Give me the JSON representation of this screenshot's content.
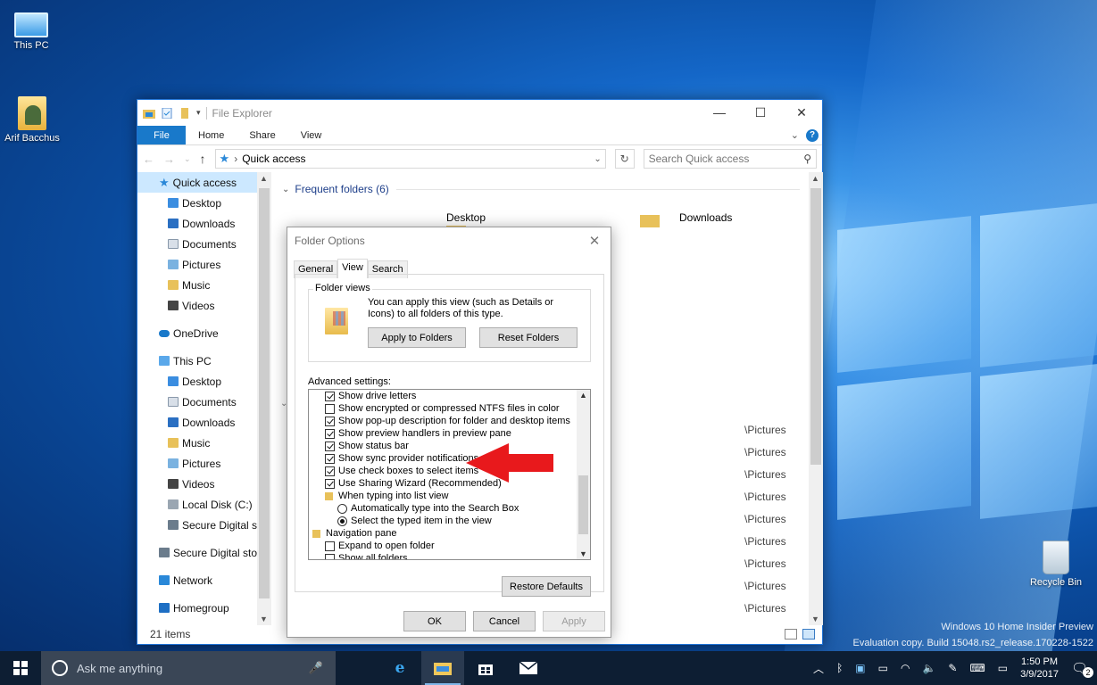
{
  "desktop": {
    "icons": [
      {
        "label": "This PC"
      },
      {
        "label": "Arif Bacchus"
      },
      {
        "label": "Recycle Bin"
      }
    ],
    "watermark_line1": "Windows 10 Home Insider Preview",
    "watermark_line2": "Evaluation copy. Build 15048.rs2_release.170228-1522"
  },
  "explorer": {
    "title": "File Explorer",
    "tabs": [
      "File",
      "Home",
      "Share",
      "View"
    ],
    "address": "Quick access",
    "search_placeholder": "Search Quick access",
    "nav": {
      "quick_access": "Quick access",
      "quick_items": [
        "Desktop",
        "Downloads",
        "Documents",
        "Pictures",
        "Music",
        "Videos"
      ],
      "onedrive": "OneDrive",
      "this_pc": "This PC",
      "pc_items": [
        "Desktop",
        "Documents",
        "Downloads",
        "Music",
        "Pictures",
        "Videos",
        "Local Disk (C:)",
        "Secure Digital sto"
      ],
      "secure_digital": "Secure Digital stor",
      "network": "Network",
      "homegroup": "Homegroup"
    },
    "frequent_folders": "Frequent folders (6)",
    "frequent_items": [
      "Desktop",
      "Downloads"
    ],
    "recent_paths": [
      "\\Pictures",
      "\\Pictures",
      "\\Pictures",
      "\\Pictures",
      "\\Pictures",
      "\\Pictures",
      "\\Pictures",
      "\\Pictures",
      "\\Pictures"
    ],
    "status": "21 items"
  },
  "dialog": {
    "title": "Folder Options",
    "tabs": [
      "General",
      "View",
      "Search"
    ],
    "folder_views_label": "Folder views",
    "folder_views_text": "You can apply this view (such as Details or Icons) to all folders of this type.",
    "apply_to_folders": "Apply to Folders",
    "reset_folders": "Reset Folders",
    "advanced_label": "Advanced settings:",
    "advanced_items": [
      {
        "type": "checkbox",
        "checked": true,
        "label": "Show drive letters",
        "indent": 1
      },
      {
        "type": "checkbox",
        "checked": false,
        "label": "Show encrypted or compressed NTFS files in color",
        "indent": 1
      },
      {
        "type": "checkbox",
        "checked": true,
        "label": "Show pop-up description for folder and desktop items",
        "indent": 1
      },
      {
        "type": "checkbox",
        "checked": true,
        "label": "Show preview handlers in preview pane",
        "indent": 1
      },
      {
        "type": "checkbox",
        "checked": true,
        "label": "Show status bar",
        "indent": 1
      },
      {
        "type": "checkbox",
        "checked": true,
        "label": "Show sync provider notifications",
        "indent": 1
      },
      {
        "type": "checkbox",
        "checked": true,
        "label": "Use check boxes to select items",
        "indent": 1
      },
      {
        "type": "checkbox",
        "checked": true,
        "label": "Use Sharing Wizard (Recommended)",
        "indent": 1
      },
      {
        "type": "folder",
        "label": "When typing into list view",
        "indent": 1
      },
      {
        "type": "radio",
        "checked": false,
        "label": "Automatically type into the Search Box",
        "indent": 2
      },
      {
        "type": "radio",
        "checked": true,
        "label": "Select the typed item in the view",
        "indent": 2
      },
      {
        "type": "folder",
        "label": "Navigation pane",
        "indent": 0
      },
      {
        "type": "checkbox",
        "checked": false,
        "label": "Expand to open folder",
        "indent": 1
      },
      {
        "type": "checkbox",
        "checked": false,
        "label": "Show all folders",
        "indent": 1
      }
    ],
    "restore_defaults": "Restore Defaults",
    "ok": "OK",
    "cancel": "Cancel",
    "apply": "Apply"
  },
  "taskbar": {
    "search_placeholder": "Ask me anything",
    "time": "1:50 PM",
    "date": "3/9/2017",
    "notification_count": "2"
  },
  "colors": {
    "accent": "#1979ca",
    "arrow": "#e8191c",
    "taskbar": "#0d1e33"
  }
}
